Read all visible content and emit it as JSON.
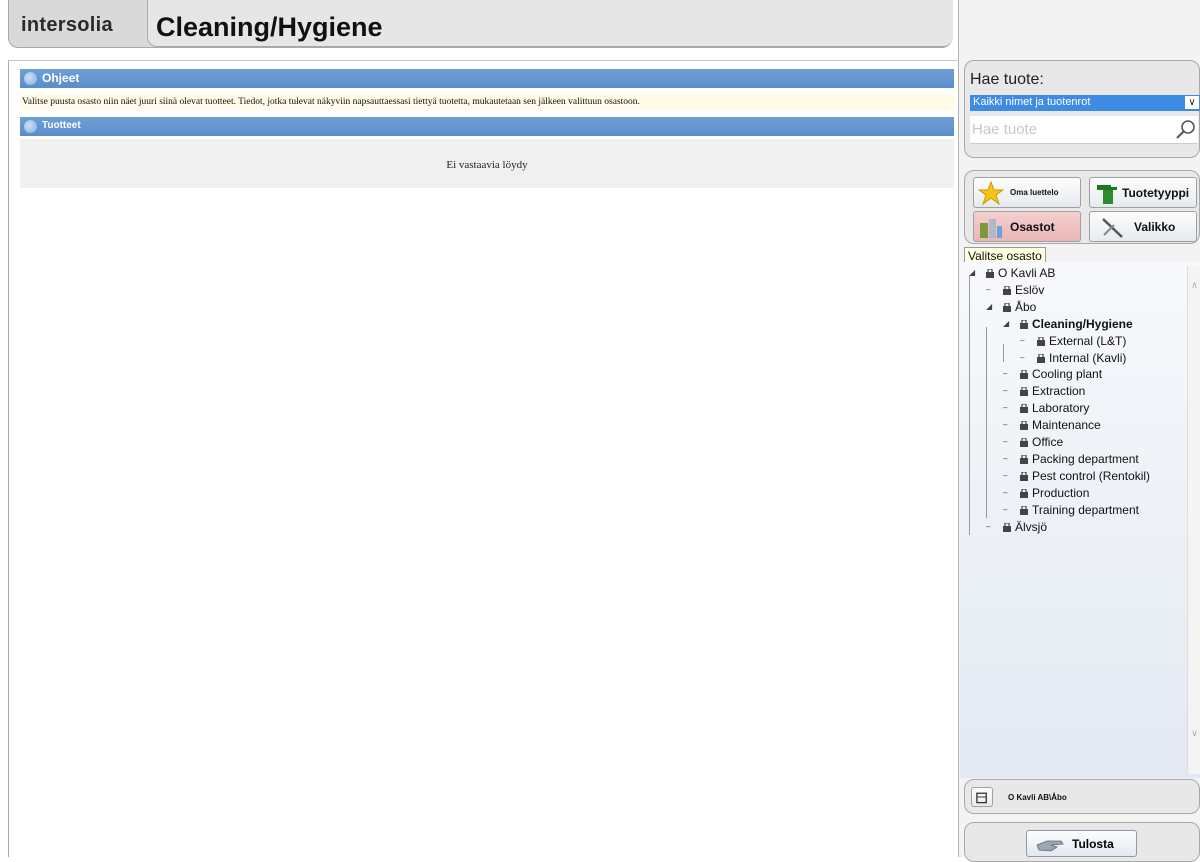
{
  "header": {
    "logo": "intersolia",
    "title": "Cleaning/Hygiene"
  },
  "main": {
    "instructions_title": "Ohjeet",
    "instructions_text": "Valitse puusta osasto niin näet juuri siinä olevat tuotteet. Tiedot, jotka tulevat näkyviin napsauttaessasi tiettyä tuotetta, mukautetaan sen jälkeen valittuun osastoon.",
    "products_title": "Tuotteet",
    "empty_message": "Ei vastaavia löydy"
  },
  "search": {
    "label": "Hae tuote:",
    "selected_option": "Kaikki nimet ja tuotenrot",
    "placeholder": "Hae tuote"
  },
  "nav": {
    "my_list": "Oma luettelo",
    "product_type": "Tuotetyyppi",
    "departments": "Osastot",
    "menu": "Valikko"
  },
  "tree": {
    "tooltip": "Valitse osasto",
    "items": [
      {
        "label": "O Kavli AB"
      },
      {
        "label": "Eslöv"
      },
      {
        "label": "Åbo"
      },
      {
        "label": "Cleaning/Hygiene"
      },
      {
        "label": "External (L&T)"
      },
      {
        "label": "Internal (Kavli)"
      },
      {
        "label": "Cooling plant"
      },
      {
        "label": "Extraction"
      },
      {
        "label": "Laboratory"
      },
      {
        "label": "Maintenance"
      },
      {
        "label": "Office"
      },
      {
        "label": "Packing department"
      },
      {
        "label": "Pest control (Rentokil)"
      },
      {
        "label": "Production"
      },
      {
        "label": "Training department"
      },
      {
        "label": "Älvsjö"
      }
    ]
  },
  "footer": {
    "path": "O Kavli AB\\Åbo",
    "print_label": "Tulosta"
  }
}
